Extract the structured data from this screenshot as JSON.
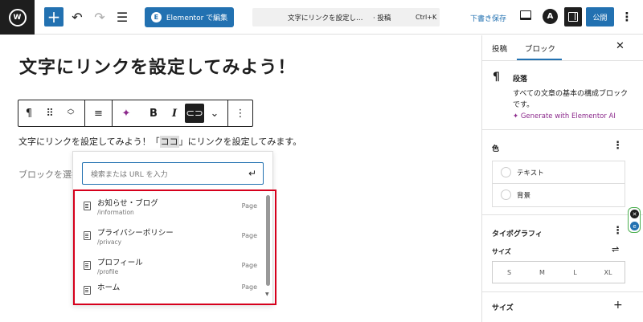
{
  "topbar": {
    "elementor_label": "Elementor で編集",
    "doc_title": "文字にリンクを設定し…",
    "doc_type": "· 投稿",
    "shortcut": "Ctrl+K",
    "save_draft": "下書き保存",
    "publish": "公開"
  },
  "editor": {
    "heading": "文字にリンクを設定してみよう！",
    "paragraph_before": "文字にリンクを設定してみよう！「",
    "paragraph_highlight": "ココ",
    "paragraph_after": "」にリンクを設定してみます。",
    "placeholder": "ブロックを選択"
  },
  "link_popover": {
    "search_placeholder": "検索または URL を入力",
    "suggestions": [
      {
        "title": "お知らせ・ブログ",
        "path": "/information",
        "type": "Page"
      },
      {
        "title": "プライバシーポリシー",
        "path": "/privacy",
        "type": "Page"
      },
      {
        "title": "プロフィール",
        "path": "/profile",
        "type": "Page"
      },
      {
        "title": "ホーム",
        "path": "",
        "type": "Page"
      }
    ]
  },
  "sidebar": {
    "tabs": [
      "投稿",
      "ブロック"
    ],
    "active_tab": "ブロック",
    "block_name": "段落",
    "block_desc": "すべての文章の基本の構成ブロックです。",
    "generate_ai": "Generate with Elementor AI",
    "color_title": "色",
    "color_items": [
      "テキスト",
      "背景"
    ],
    "typography_title": "タイポグラフィ",
    "size_label": "サイズ",
    "size_options": [
      "S",
      "M",
      "L",
      "XL"
    ],
    "dimensions_title": "サイズ"
  },
  "colors": {
    "accent": "#2271b1",
    "highlight_box": "#d6001c",
    "ai": "#8c2a8c"
  }
}
